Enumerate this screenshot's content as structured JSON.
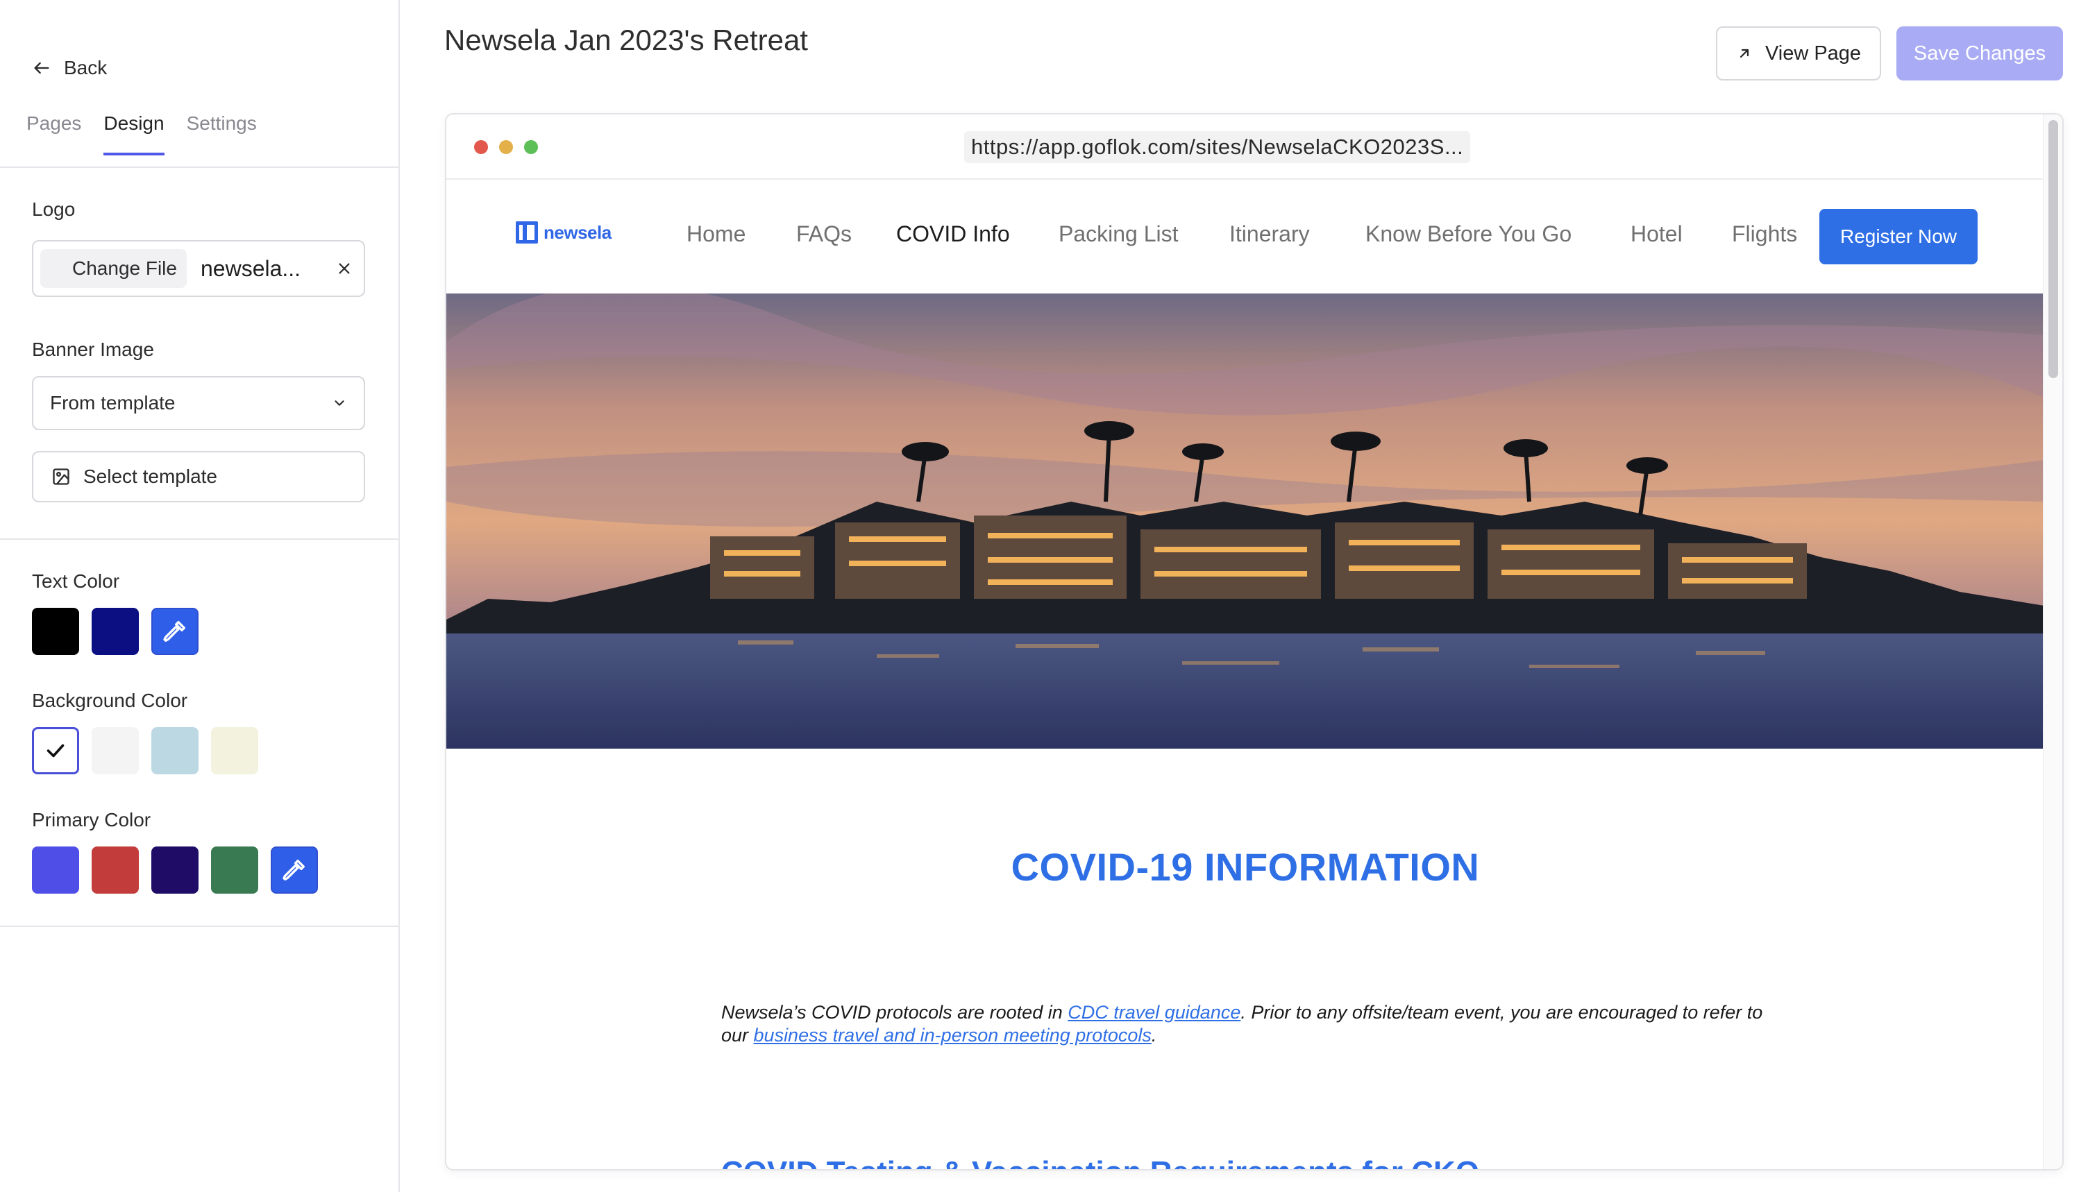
{
  "sidebar": {
    "back_label": "Back",
    "tabs": [
      {
        "label": "Pages"
      },
      {
        "label": "Design"
      },
      {
        "label": "Settings"
      }
    ],
    "logo": {
      "label": "Logo",
      "change_file_label": "Change File",
      "file_name": "newsela..."
    },
    "banner": {
      "label": "Banner Image",
      "selected_value": "From template",
      "select_template_label": "Select template"
    },
    "text_color": {
      "label": "Text Color",
      "swatches": [
        "#000000",
        "#0b0f82"
      ]
    },
    "background_color": {
      "label": "Background Color",
      "swatches": [
        "#ffffff",
        "#f4f4f4",
        "#bcd8e3",
        "#f3f2de"
      ]
    },
    "primary_color": {
      "label": "Primary Color",
      "swatches": [
        "#4f4fe8",
        "#c23c3c",
        "#1e0c66",
        "#3a7a52"
      ]
    }
  },
  "header": {
    "title": "Newsela Jan 2023's Retreat",
    "view_page_label": "View Page",
    "save_label": "Save Changes"
  },
  "browser": {
    "url": "https://app.goflok.com/sites/NewselaCKO2023S..."
  },
  "site": {
    "logo_text": "newsela",
    "nav": [
      "Home",
      "FAQs",
      "COVID Info",
      "Packing List",
      "Itinerary",
      "Know Before You Go",
      "Hotel",
      "Flights"
    ],
    "active_nav": "COVID Info",
    "register_label": "Register Now",
    "heading": "COVID-19 INFORMATION",
    "body": {
      "part1": "Newsela’s COVID protocols are rooted in ",
      "link1": "CDC travel guidance",
      "part2": ". Prior to any offsite/team event, you are encouraged to refer to our ",
      "link2": "business travel and in-person meeting protocols",
      "part3": "."
    },
    "subheading": "COVID Testing & Vaccination Requirements for CKO"
  },
  "colors": {
    "accent": "#4f58e6",
    "site_primary": "#2f6fe6",
    "save_disabled": "#a9acf4"
  }
}
